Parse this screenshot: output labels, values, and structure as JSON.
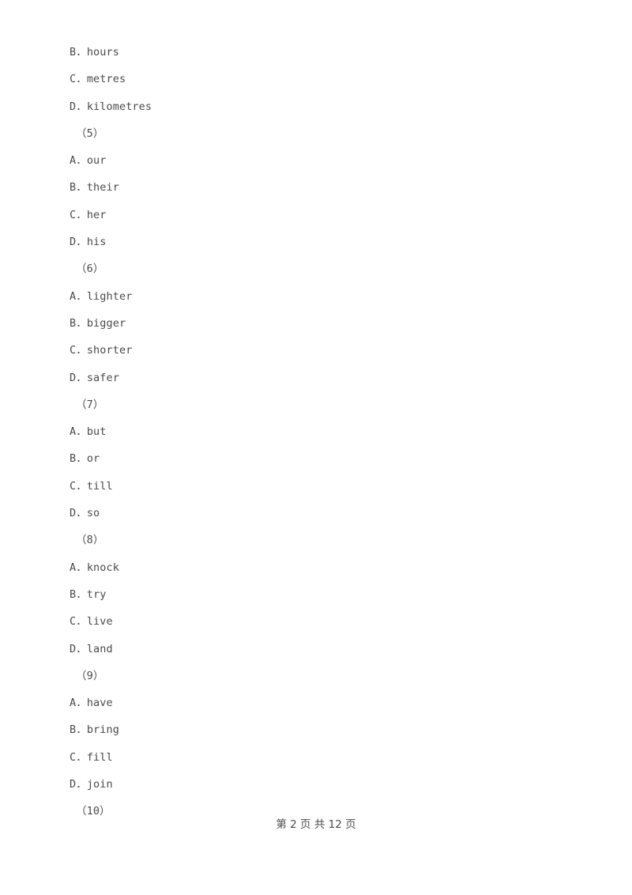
{
  "document": {
    "type": "exam-worksheet-page",
    "background_color": "#ffffff",
    "text_color": "#4a4a4a"
  },
  "body_lines": [
    {
      "kind": "option",
      "text": "B．hours"
    },
    {
      "kind": "option",
      "text": "C．metres"
    },
    {
      "kind": "option",
      "text": "D．kilometres"
    },
    {
      "kind": "question-number",
      "text": "（5）"
    },
    {
      "kind": "option",
      "text": "A．our"
    },
    {
      "kind": "option",
      "text": "B．their"
    },
    {
      "kind": "option",
      "text": "C．her"
    },
    {
      "kind": "option",
      "text": "D．his"
    },
    {
      "kind": "question-number",
      "text": "（6）"
    },
    {
      "kind": "option",
      "text": "A．lighter"
    },
    {
      "kind": "option",
      "text": "B．bigger"
    },
    {
      "kind": "option",
      "text": "C．shorter"
    },
    {
      "kind": "option",
      "text": "D．safer"
    },
    {
      "kind": "question-number",
      "text": "（7）"
    },
    {
      "kind": "option",
      "text": "A．but"
    },
    {
      "kind": "option",
      "text": "B．or"
    },
    {
      "kind": "option",
      "text": "C．till"
    },
    {
      "kind": "option",
      "text": "D．so"
    },
    {
      "kind": "question-number",
      "text": "（8）"
    },
    {
      "kind": "option",
      "text": "A．knock"
    },
    {
      "kind": "option",
      "text": "B．try"
    },
    {
      "kind": "option",
      "text": "C．live"
    },
    {
      "kind": "option",
      "text": "D．land"
    },
    {
      "kind": "question-number",
      "text": "（9）"
    },
    {
      "kind": "option",
      "text": "A．have"
    },
    {
      "kind": "option",
      "text": "B．bring"
    },
    {
      "kind": "option",
      "text": "C．fill"
    },
    {
      "kind": "option",
      "text": "D．join"
    },
    {
      "kind": "question-number",
      "text": "（10）"
    }
  ],
  "footer": {
    "text": "第 2 页 共 12 页",
    "current_page": "2",
    "total_pages": "12"
  }
}
